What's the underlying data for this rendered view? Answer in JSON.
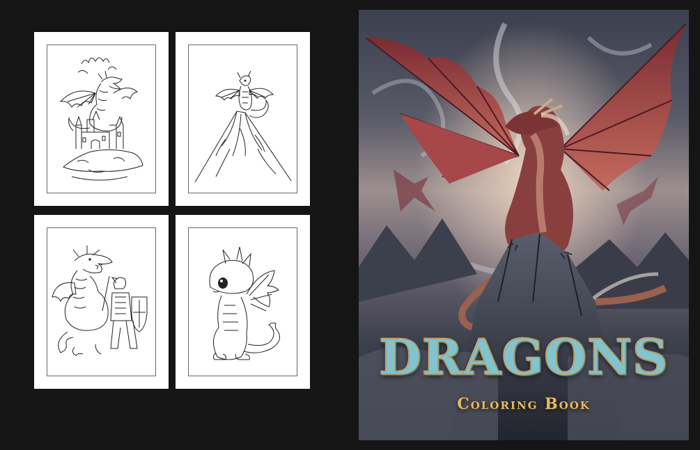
{
  "pages": [
    {
      "subject": "dragon-on-castle"
    },
    {
      "subject": "dragon-on-mountain"
    },
    {
      "subject": "dragon-with-knight"
    },
    {
      "subject": "cute-baby-dragon"
    }
  ],
  "cover": {
    "title": "DRAGONS",
    "subtitle": "Coloring Book",
    "colors": {
      "title": "#7fc4cf",
      "title_outline": "#c49a56",
      "subtitle": "#e2b86a",
      "dragon": "#8a3b3b",
      "wing": "#b0504a"
    }
  },
  "icons": [
    "dragon-illustration",
    "castle-illustration",
    "mountain-illustration",
    "knight-illustration",
    "baby-dragon-illustration"
  ]
}
